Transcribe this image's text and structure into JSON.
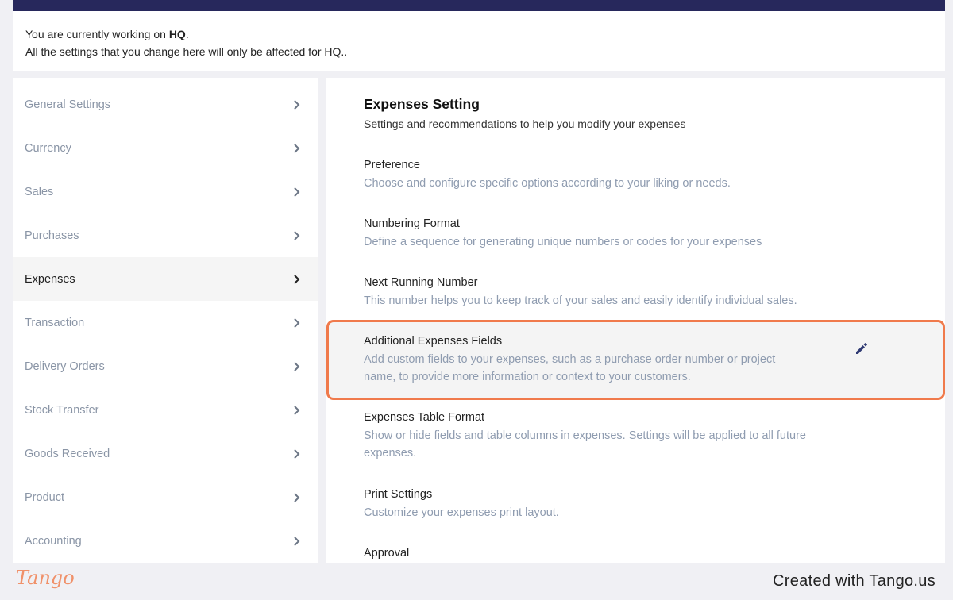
{
  "notice": {
    "line1_prefix": "You are currently working on ",
    "workspace": "HQ",
    "line1_suffix": ".",
    "line2": "All the settings that you change here will only be affected for HQ.."
  },
  "sidebar": {
    "items": [
      {
        "label": "General Settings"
      },
      {
        "label": "Currency"
      },
      {
        "label": "Sales"
      },
      {
        "label": "Purchases"
      },
      {
        "label": "Expenses"
      },
      {
        "label": "Transaction"
      },
      {
        "label": "Delivery Orders"
      },
      {
        "label": "Stock Transfer"
      },
      {
        "label": "Goods Received"
      },
      {
        "label": "Product"
      },
      {
        "label": "Accounting"
      }
    ],
    "active": "Expenses"
  },
  "main": {
    "title": "Expenses Setting",
    "subtitle": "Settings and recommendations to help you modify your expenses",
    "options": [
      {
        "title": "Preference",
        "desc": "Choose and configure specific options according to your liking or needs."
      },
      {
        "title": "Numbering Format",
        "desc": "Define a sequence for generating unique numbers or codes for your expenses"
      },
      {
        "title": "Next Running Number",
        "desc": "This number helps you to keep track of your sales and easily identify individual sales."
      },
      {
        "title": "Additional Expenses Fields",
        "desc": "Add custom fields to your expenses, such as a purchase order number or project name, to provide more information or context to your customers."
      },
      {
        "title": "Expenses Table Format",
        "desc": "Show or hide fields and table columns in expenses. Settings will be applied to all future expenses."
      },
      {
        "title": "Print Settings",
        "desc": "Customize your expenses print layout."
      },
      {
        "title": "Approval",
        "desc": ""
      }
    ]
  },
  "footer": {
    "logo": "Tango",
    "credit": "Created with Tango.us"
  },
  "colors": {
    "topbar": "#27285c",
    "highlight_border": "#f07a4c",
    "muted_text": "#8f9cb0",
    "edit_icon": "#2f3a73"
  },
  "icons": {
    "chevron": "chevron-right-icon",
    "edit": "pencil-icon"
  }
}
